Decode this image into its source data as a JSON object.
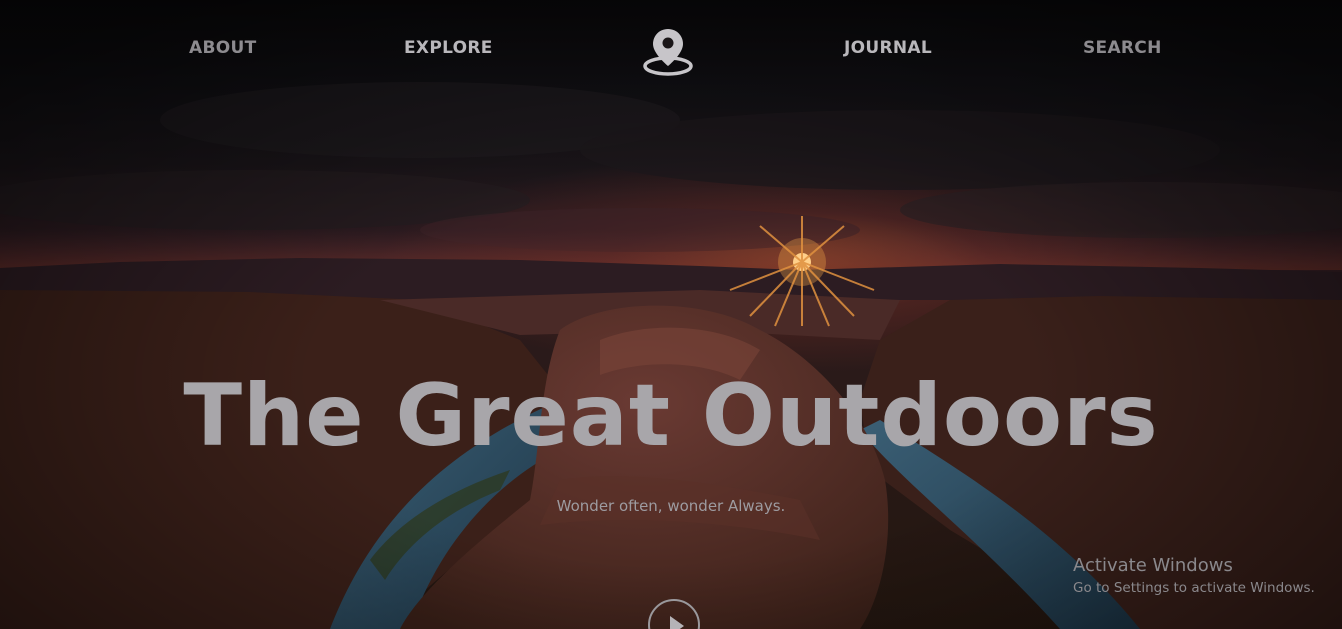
{
  "nav": {
    "about": "ABOUT",
    "explore": "EXPLORE",
    "journal": "JOURNAL",
    "search": "SEARCH",
    "logo_icon": "map-pin-icon"
  },
  "hero": {
    "title": "The Great Outdoors",
    "tagline": "Wonder often, wonder Always.",
    "play_icon": "play-icon"
  },
  "watermark": {
    "title": "Activate Windows",
    "subtitle": "Go to Settings to activate Windows."
  },
  "colors": {
    "overlay": "#0b0a0c",
    "headline": "#a8a6aa",
    "nav_text": "#b9b7bb",
    "sun": "#e0913f"
  }
}
